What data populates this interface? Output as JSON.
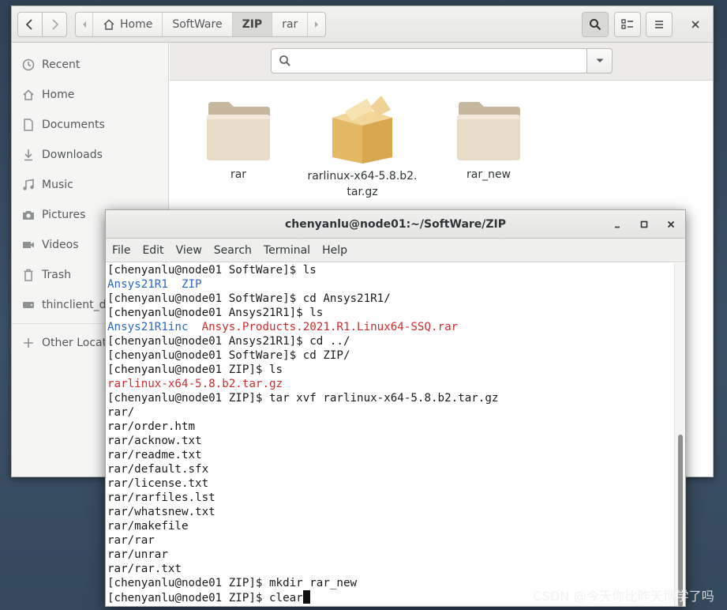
{
  "file_manager": {
    "breadcrumb": [
      "Home",
      "SoftWare",
      "ZIP",
      "rar"
    ],
    "active_crumb": "ZIP",
    "search_placeholder": "",
    "sidebar": [
      {
        "label": "Recent",
        "icon": "clock-icon"
      },
      {
        "label": "Home",
        "icon": "home-icon"
      },
      {
        "label": "Documents",
        "icon": "document-icon"
      },
      {
        "label": "Downloads",
        "icon": "download-icon"
      },
      {
        "label": "Music",
        "icon": "music-icon"
      },
      {
        "label": "Pictures",
        "icon": "camera-icon"
      },
      {
        "label": "Videos",
        "icon": "video-icon"
      },
      {
        "label": "Trash",
        "icon": "trash-icon"
      },
      {
        "label": "thinclient_drives",
        "icon": "drive-icon"
      },
      {
        "label": "Other Locations",
        "icon": "plus-icon"
      }
    ],
    "files": [
      {
        "name": "rar",
        "kind": "folder"
      },
      {
        "name": "rarlinux-x64-5.8.b2.\ntar.gz",
        "kind": "archive"
      },
      {
        "name": "rar_new",
        "kind": "folder"
      }
    ]
  },
  "terminal": {
    "title": "chenyanlu@node01:~/SoftWare/ZIP",
    "menu": [
      "File",
      "Edit",
      "View",
      "Search",
      "Terminal",
      "Help"
    ],
    "lines": [
      [
        {
          "t": "[chenyanlu@node01 SoftWare]$ ls",
          "c": "plain"
        }
      ],
      [
        {
          "t": "Ansys21R1",
          "c": "blue"
        },
        {
          "t": "  ",
          "c": "plain"
        },
        {
          "t": "ZIP",
          "c": "blue"
        }
      ],
      [
        {
          "t": "[chenyanlu@node01 SoftWare]$ cd Ansys21R1/",
          "c": "plain"
        }
      ],
      [
        {
          "t": "[chenyanlu@node01 Ansys21R1]$ ls",
          "c": "plain"
        }
      ],
      [
        {
          "t": "Ansys21R1inc",
          "c": "blue"
        },
        {
          "t": "  ",
          "c": "plain"
        },
        {
          "t": "Ansys.Products.2021.R1.Linux64-SSQ.rar",
          "c": "red"
        }
      ],
      [
        {
          "t": "[chenyanlu@node01 Ansys21R1]$ cd ../",
          "c": "plain"
        }
      ],
      [
        {
          "t": "[chenyanlu@node01 SoftWare]$ cd ZIP/",
          "c": "plain"
        }
      ],
      [
        {
          "t": "[chenyanlu@node01 ZIP]$ ls",
          "c": "plain"
        }
      ],
      [
        {
          "t": "rarlinux-x64-5.8.b2.tar.gz",
          "c": "red"
        }
      ],
      [
        {
          "t": "[chenyanlu@node01 ZIP]$ tar xvf rarlinux-x64-5.8.b2.tar.gz",
          "c": "plain"
        }
      ],
      [
        {
          "t": "rar/",
          "c": "plain"
        }
      ],
      [
        {
          "t": "rar/order.htm",
          "c": "plain"
        }
      ],
      [
        {
          "t": "rar/acknow.txt",
          "c": "plain"
        }
      ],
      [
        {
          "t": "rar/readme.txt",
          "c": "plain"
        }
      ],
      [
        {
          "t": "rar/default.sfx",
          "c": "plain"
        }
      ],
      [
        {
          "t": "rar/license.txt",
          "c": "plain"
        }
      ],
      [
        {
          "t": "rar/rarfiles.lst",
          "c": "plain"
        }
      ],
      [
        {
          "t": "rar/whatsnew.txt",
          "c": "plain"
        }
      ],
      [
        {
          "t": "rar/makefile",
          "c": "plain"
        }
      ],
      [
        {
          "t": "rar/rar",
          "c": "plain"
        }
      ],
      [
        {
          "t": "rar/unrar",
          "c": "plain"
        }
      ],
      [
        {
          "t": "rar/rar.txt",
          "c": "plain"
        }
      ],
      [
        {
          "t": "[chenyanlu@node01 ZIP]$ mkdir rar_new",
          "c": "plain"
        }
      ],
      [
        {
          "t": "[chenyanlu@node01 ZIP]$ clear",
          "c": "plain"
        }
      ]
    ]
  },
  "watermark": "CSDN @今天你比昨天博学了吗",
  "colors": {
    "ls_dir": "#2a66c8",
    "ls_archive": "#d02c2c",
    "folder": "#dccdb4",
    "archive": "#e8c06e"
  }
}
